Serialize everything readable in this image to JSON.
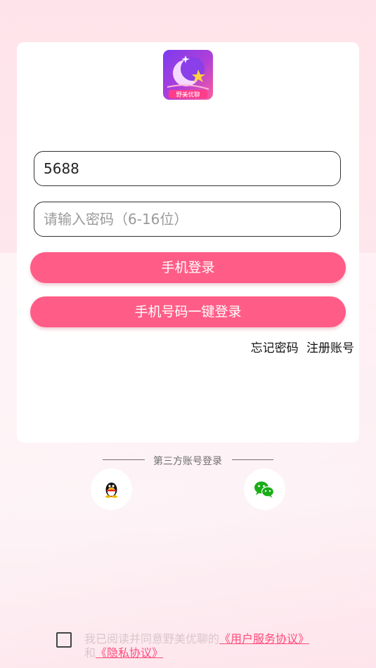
{
  "login": {
    "app_logo_text": "野美优聊",
    "account_value": "5688",
    "password_placeholder": "请输入密码（6-16位）",
    "phone_login_label": "手机登录",
    "one_click_login_label": "手机号码一键登录",
    "forgot_password_label": "忘记密码",
    "register_label": "注册账号"
  },
  "third_party": {
    "label": "第三方账号登录",
    "providers": [
      {
        "name": "qq",
        "icon": "qq-icon"
      },
      {
        "name": "wechat",
        "icon": "wechat-icon"
      }
    ]
  },
  "agreement": {
    "prefix": "我已阅读并同意野美优聊的",
    "user_agreement": "《用户服务协议》",
    "and": "和",
    "privacy": "《隐私协议》",
    "checked": false
  },
  "colors": {
    "accent": "#ff5d87",
    "background": "#ffe3ea",
    "link": "#ff4a7a"
  }
}
